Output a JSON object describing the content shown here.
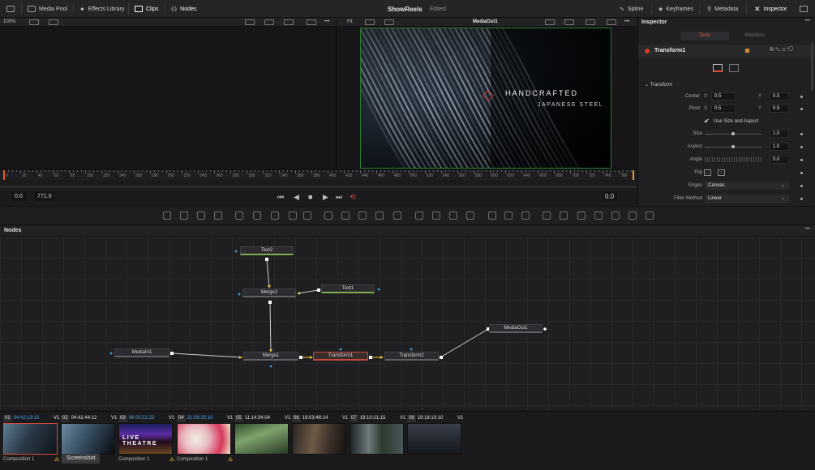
{
  "topbar": {
    "media_pool": "Media Pool",
    "effects_library": "Effects Library",
    "clips": "Clips",
    "nodes": "Nodes",
    "project_name": "ShowReels",
    "project_status": "Edited",
    "spline": "Spline",
    "keyframes": "Keyframes",
    "metadata": "Metadata",
    "inspector": "Inspector"
  },
  "viewer": {
    "zoom_left": "100%",
    "fit_label": "Fit",
    "right_title": "MediaOut1",
    "image_text_line1": "HANDCRAFTED",
    "image_text_line2": "JAPANESE STEEL"
  },
  "ruler": {
    "ticks": [
      "0",
      "20",
      "40",
      "60",
      "80",
      "100",
      "120",
      "140",
      "160",
      "180",
      "200",
      "220",
      "240",
      "260",
      "280",
      "300",
      "320",
      "340",
      "360",
      "380",
      "400",
      "420",
      "440",
      "460",
      "480",
      "500",
      "520",
      "540",
      "560",
      "580",
      "600",
      "620",
      "640",
      "660",
      "680",
      "700",
      "720",
      "740",
      "760"
    ]
  },
  "transport": {
    "start": "0.0",
    "end": "771.0",
    "current": "0.0"
  },
  "nodes_panel": {
    "title": "Nodes",
    "nodes": {
      "text2": "Text2",
      "merge2": "Merge2",
      "text1": "Text1",
      "mediain1": "MediaIn1",
      "merge1": "Merge1",
      "transform1": "Transform1",
      "transform2": "Transform2",
      "mediaout1": "MediaOut1"
    }
  },
  "inspector": {
    "title": "Inspector",
    "tab_tools": "Tools",
    "tab_modifiers": "Modifiers",
    "node_name": "Transform1",
    "section": "Transform",
    "center_label": "Center",
    "center_x": "0.5",
    "center_y": "0.5",
    "pivot_label": "Pivot",
    "pivot_x": "0.5",
    "pivot_y": "0.5",
    "x_label": "X",
    "y_label": "Y",
    "use_size": "Use Size and Aspect",
    "size_label": "Size",
    "size_value": "1.0",
    "aspect_label": "Aspect",
    "aspect_value": "1.0",
    "angle_label": "Angle",
    "angle_value": "0.0",
    "flip_label": "Flip",
    "edges_label": "Edges",
    "edges_value": "Canvas",
    "filter_label": "Filter Method",
    "filter_value": "Linear"
  },
  "bin": {
    "clips": [
      {
        "num": "01",
        "tc": "04:42:13:15",
        "track": "V1",
        "name": "Composition 1",
        "tc_color": "#4aa3e8"
      },
      {
        "num": "02",
        "tc": "04:42:44:12",
        "track": "V1",
        "name": "",
        "tc_color": "#e5e5e5"
      },
      {
        "num": "03",
        "tc": "06:00:21:23",
        "track": "V1",
        "name": "Composition 1",
        "tc_color": "#4aa3e8"
      },
      {
        "num": "04",
        "tc": "21:08:25:10",
        "track": "V1",
        "name": "Composition 1",
        "tc_color": "#4aa3e8"
      },
      {
        "num": "05",
        "tc": "11:14:34:04",
        "track": "V1",
        "name": "",
        "tc_color": "#e5e5e5"
      },
      {
        "num": "06",
        "tc": "19:03:46:14",
        "track": "V1",
        "name": "",
        "tc_color": "#e5e5e5"
      },
      {
        "num": "07",
        "tc": "19:10:21:15",
        "track": "V1",
        "name": "",
        "tc_color": "#e5e5e5"
      },
      {
        "num": "08",
        "tc": "19:18:10:10",
        "track": "V1",
        "name": "",
        "tc_color": "#e5e5e5"
      }
    ],
    "tooltip": "Screenshot",
    "clip3_text": "LIVE THEATRE"
  }
}
